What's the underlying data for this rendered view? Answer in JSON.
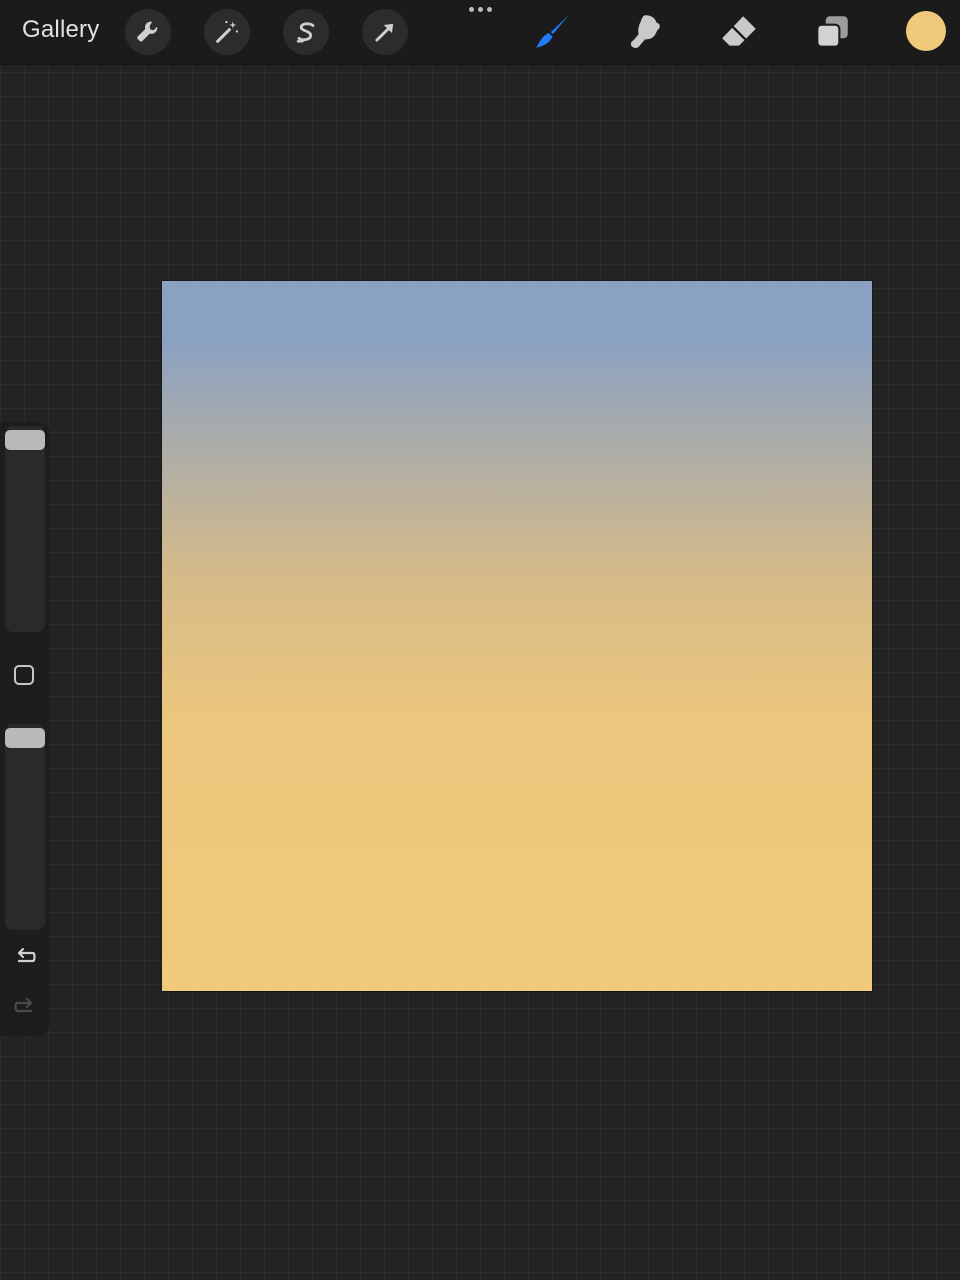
{
  "topbar": {
    "gallery_label": "Gallery",
    "left_tools": [
      "wrench-icon",
      "magic-wand-icon",
      "selection-s-icon",
      "move-arrow-icon"
    ],
    "right_tools": [
      "brush-icon",
      "smudge-icon",
      "eraser-icon",
      "layers-icon"
    ],
    "active_tool": "brush-icon"
  },
  "colors": {
    "active_tool": "#1f7cff",
    "inactive_tool": "#c9c9c9",
    "current_color": "#f0c97a",
    "canvas_top": "#8aa1c3",
    "canvas_mid": "#d6bb88",
    "canvas_bottom": "#f0c97a"
  },
  "sidebar": {
    "brush_size": 1.0,
    "opacity": 1.0,
    "controls": [
      "modify-icon",
      "undo-icon",
      "redo-icon"
    ]
  }
}
